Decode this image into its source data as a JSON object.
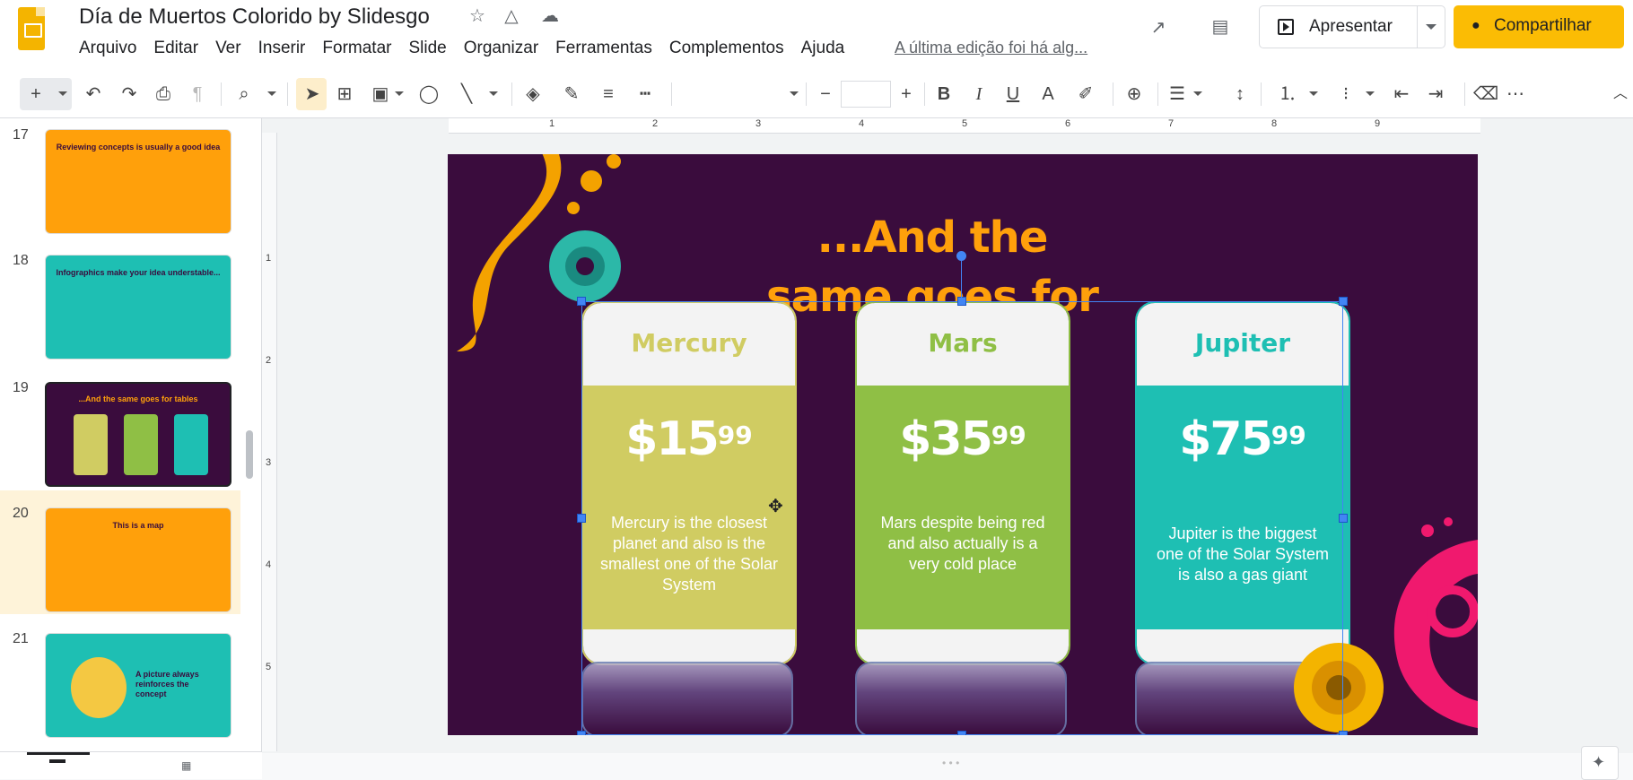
{
  "header": {
    "doc_title": "Día de Muertos Colorido by Slidesgo",
    "icons": [
      "star-icon",
      "drive-icon",
      "cloud-icon",
      "trend-icon",
      "comment-icon"
    ],
    "menu": [
      "Arquivo",
      "Editar",
      "Ver",
      "Inserir",
      "Formatar",
      "Slide",
      "Organizar",
      "Ferramentas",
      "Complementos",
      "Ajuda"
    ],
    "last_edit": "A última edição foi há alg...",
    "present_label": "Apresentar",
    "share_label": "Compartilhar"
  },
  "toolbar": {
    "new": "+",
    "undo": "↶",
    "redo": "↷",
    "print": "⎙",
    "zoom": "⌕",
    "minus": "−",
    "plus": "+",
    "bold": "B",
    "italic": "I",
    "underline": "U",
    "text_color": "A",
    "more": "⋯",
    "font_size_value": ""
  },
  "ruler": {
    "top_marks": [
      "1",
      "2",
      "3",
      "4",
      "5",
      "6",
      "7",
      "8",
      "9"
    ],
    "left_marks": [
      "1",
      "2",
      "3",
      "4",
      "5"
    ]
  },
  "slides": [
    {
      "num": "17",
      "title": "Reviewing concepts is usually a good idea",
      "bg": "#ffa00b",
      "fg": "#3a0c3d"
    },
    {
      "num": "18",
      "title": "Infographics make your idea understable...",
      "bg": "#1ebfb3",
      "fg": "#3a0c3d"
    },
    {
      "num": "19",
      "title": "...And the same goes for tables",
      "bg": "#3a0c3d",
      "fg": "#ffa00b"
    },
    {
      "num": "20",
      "title": "This is a map",
      "bg": "#ffa00b",
      "fg": "#3a0c3d"
    },
    {
      "num": "21",
      "title": "A picture always reinforces the concept",
      "bg": "#1ebfb3",
      "fg": "#3a0c3d"
    }
  ],
  "slide": {
    "title": "...And the same goes for tables",
    "cards": [
      {
        "name": "Mercury",
        "price": "$15",
        "cents": "99",
        "desc": "Mercury is the closest planet and also is the smallest one of the Solar System",
        "color": "#d0cc62",
        "name_color": "#d0cc62"
      },
      {
        "name": "Mars",
        "price": "$35",
        "cents": "99",
        "desc": "Mars despite being red and also actually is a very cold place",
        "color": "#8fbf45",
        "name_color": "#8fbf45"
      },
      {
        "name": "Jupiter",
        "price": "$75",
        "cents": "99",
        "desc": "Jupiter is the biggest one of the Solar System is also a gas giant",
        "color": "#1ebfb3",
        "name_color": "#1ebfb3"
      }
    ]
  },
  "colors": {
    "accent_yellow": "#fbbc04",
    "slide_bg": "#3a0c3d",
    "title_orange": "#ffa00b",
    "selection_blue": "#4285f4"
  }
}
